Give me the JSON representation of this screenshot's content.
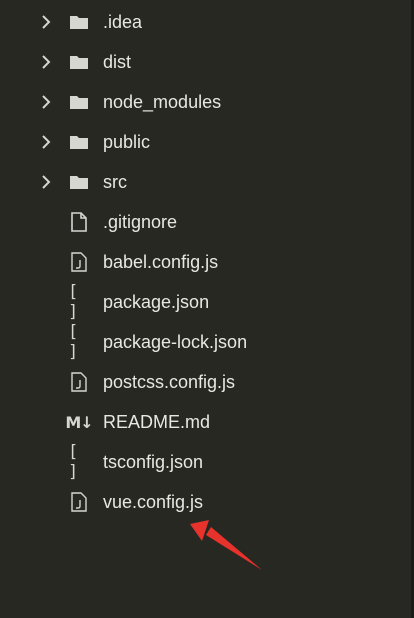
{
  "explorer": {
    "items": [
      {
        "type": "folder",
        "label": ".idea",
        "icon": "folder-icon"
      },
      {
        "type": "folder",
        "label": "dist",
        "icon": "folder-icon"
      },
      {
        "type": "folder",
        "label": "node_modules",
        "icon": "folder-icon"
      },
      {
        "type": "folder",
        "label": "public",
        "icon": "folder-icon"
      },
      {
        "type": "folder",
        "label": "src",
        "icon": "folder-icon"
      },
      {
        "type": "file",
        "label": ".gitignore",
        "icon": "file-icon"
      },
      {
        "type": "file",
        "label": "babel.config.js",
        "icon": "js-file-icon"
      },
      {
        "type": "file",
        "label": "package.json",
        "icon": "json-file-icon",
        "glyph": "[ ]"
      },
      {
        "type": "file",
        "label": "package-lock.json",
        "icon": "json-file-icon",
        "glyph": "[ ]"
      },
      {
        "type": "file",
        "label": "postcss.config.js",
        "icon": "js-file-icon"
      },
      {
        "type": "file",
        "label": "README.md",
        "icon": "markdown-file-icon",
        "glyph": "M↓"
      },
      {
        "type": "file",
        "label": "tsconfig.json",
        "icon": "json-file-icon",
        "glyph": "[ ]"
      },
      {
        "type": "file",
        "label": "vue.config.js",
        "icon": "js-file-icon"
      }
    ]
  },
  "annotation": {
    "icon": "red-arrow-icon",
    "color": "#e8322c",
    "points_to": "vue.config.js"
  },
  "colors": {
    "background": "#272822",
    "text": "#e8e8e3",
    "icon": "#d6d6d1"
  }
}
